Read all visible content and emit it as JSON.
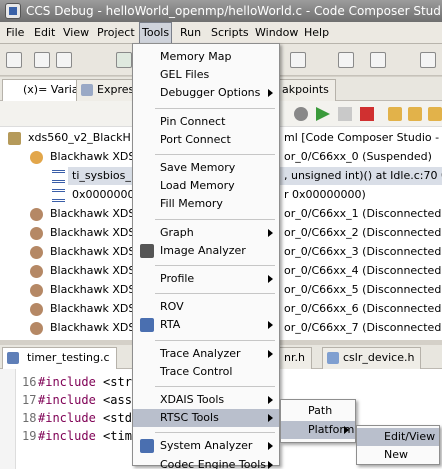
{
  "window": {
    "title": "CCS Debug - helloWorld_openmp/helloWorld.c - Code Composer Studio"
  },
  "menubar": [
    {
      "label": "File"
    },
    {
      "label": "Edit"
    },
    {
      "label": "View"
    },
    {
      "label": "Project"
    },
    {
      "label": "Tools",
      "active": true
    },
    {
      "label": "Run"
    },
    {
      "label": "Scripts"
    },
    {
      "label": "Window"
    },
    {
      "label": "Help"
    }
  ],
  "view_tabs": [
    {
      "label": "(x)= Variables",
      "icon": "variables-icon"
    },
    {
      "label": "Expressi",
      "icon": "expressions-icon"
    },
    {
      "label": "akpoints",
      "icon": "breakpoints-icon"
    }
  ],
  "debug_tree": [
    {
      "text": "xds560_v2_BlackH",
      "tail": "ml [Code Composer Studio - Device",
      "icon": "debug-target-icon",
      "depth": 0
    },
    {
      "text": "Blackhawk XDS",
      "tail": "or_0/C66xx_0 (Suspended)",
      "icon": "core-suspended-icon",
      "depth": 1
    },
    {
      "text": "ti_sysbios_",
      "tail": ", unsigned int)() at Idle.c:70 0x80",
      "icon": "stack-frame-icon",
      "depth": 2,
      "selected": true
    },
    {
      "text": "0x0000000",
      "tail": "r 0x00000000)",
      "icon": "stack-frame-icon",
      "depth": 2
    },
    {
      "text": "Blackhawk XDS",
      "tail": "or_0/C66xx_1 (Disconnected : Un",
      "icon": "core-disconnected-icon",
      "depth": 1
    },
    {
      "text": "Blackhawk XDS",
      "tail": "or_0/C66xx_2 (Disconnected : Un",
      "icon": "core-disconnected-icon",
      "depth": 1
    },
    {
      "text": "Blackhawk XDS",
      "tail": "or_0/C66xx_3 (Disconnected : Un",
      "icon": "core-disconnected-icon",
      "depth": 1
    },
    {
      "text": "Blackhawk XDS",
      "tail": "or_0/C66xx_4 (Disconnected : Un",
      "icon": "core-disconnected-icon",
      "depth": 1
    },
    {
      "text": "Blackhawk XDS",
      "tail": "or_0/C66xx_5 (Disconnected : Un",
      "icon": "core-disconnected-icon",
      "depth": 1
    },
    {
      "text": "Blackhawk XDS",
      "tail": "or_0/C66xx_6 (Disconnected : Un",
      "icon": "core-disconnected-icon",
      "depth": 1
    },
    {
      "text": "Blackhawk XDS",
      "tail": "or_0/C66xx_7 (Disconnected : Un",
      "icon": "core-disconnected-icon",
      "depth": 1
    }
  ],
  "editor_tabs": [
    {
      "label": "timer_testing.c"
    },
    {
      "label": "nr.h"
    },
    {
      "label": "cslr_device.h"
    }
  ],
  "code_lines": [
    {
      "num": "16",
      "kw": "#include",
      "rest": " <str"
    },
    {
      "num": "17",
      "kw": "#include",
      "rest": " <ass"
    },
    {
      "num": "18",
      "kw": "#include",
      "rest": " <std"
    },
    {
      "num": "19",
      "kw": "#include",
      "rest": " <tim"
    }
  ],
  "tools_menu": [
    {
      "label": "Memory Map"
    },
    {
      "label": "GEL Files"
    },
    {
      "label": "Debugger Options",
      "submenu": true
    },
    {
      "sep": true
    },
    {
      "label": "Pin Connect"
    },
    {
      "label": "Port Connect"
    },
    {
      "sep": true
    },
    {
      "label": "Save Memory"
    },
    {
      "label": "Load Memory"
    },
    {
      "label": "Fill Memory"
    },
    {
      "sep": true
    },
    {
      "label": "Graph",
      "submenu": true
    },
    {
      "label": "Image Analyzer",
      "icon": "camera-icon"
    },
    {
      "sep": true
    },
    {
      "label": "Profile",
      "submenu": true
    },
    {
      "sep": true
    },
    {
      "label": "ROV"
    },
    {
      "label": "RTA",
      "submenu": true,
      "icon": "rta-icon"
    },
    {
      "sep": true
    },
    {
      "label": "Trace Analyzer",
      "submenu": true
    },
    {
      "label": "Trace Control"
    },
    {
      "sep": true
    },
    {
      "label": "XDAIS Tools",
      "submenu": true
    },
    {
      "label": "RTSC Tools",
      "submenu": true,
      "highlighted": true
    },
    {
      "sep": true
    },
    {
      "label": "System Analyzer",
      "submenu": true,
      "icon": "system-analyzer-icon"
    },
    {
      "label": "Codec Engine Tools",
      "submenu": true
    }
  ],
  "rtsc_menu": [
    {
      "label": "Path"
    },
    {
      "label": "Platform",
      "submenu": true,
      "highlighted": true
    }
  ],
  "platform_menu": [
    {
      "label": "Edit/View",
      "highlighted": true
    },
    {
      "label": "New"
    }
  ],
  "colors": {
    "menu_highlight": "#b9bfcc",
    "selection": "#d9dee7",
    "keyword": "#7f0055"
  }
}
